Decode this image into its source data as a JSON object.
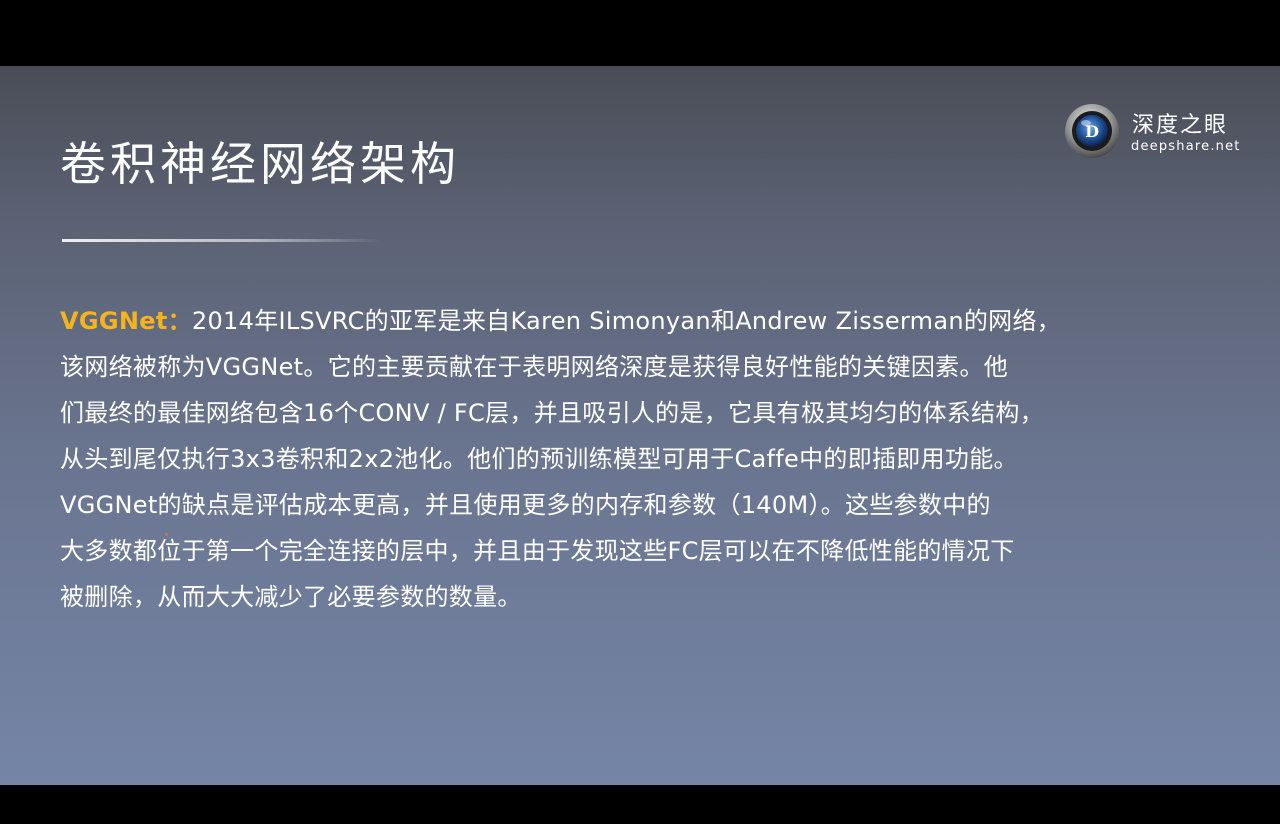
{
  "slide": {
    "title": "卷积神经网络架构",
    "logo": {
      "name": "深度之眼",
      "url": "deepshare.net",
      "badge_letter": "D"
    },
    "keyword": "VGGNet：",
    "paragraph_lines": [
      "2014年ILSVRC的亚军是来自Karen Simonyan和Andrew Zisserman的网络，",
      "该网络被称为VGGNet。它的主要贡献在于表明网络深度是获得良好性能的关键因素。他",
      "们最终的最佳网络包含16个CONV / FC层，并且吸引人的是，它具有极其均匀的体系结构，",
      "从头到尾仅执行3x3卷积和2x2池化。他们的预训练模型可用于Caffe中的即插即用功能。",
      "VGGNet的缺点是评估成本更高，并且使用更多的内存和参数（140M）。这些参数中的",
      "大多数都位于第一个完全连接的层中，并且由于发现这些FC层可以在不降低性能的情况下",
      "被删除，从而大大减少了必要参数的数量。"
    ]
  },
  "colors": {
    "keyword": "#f6b41c",
    "text": "#ffffff",
    "background_top": "#4a4d56",
    "background_bottom": "#7585a6"
  },
  "icons": {
    "logo": "eye-lens-logo-icon"
  }
}
